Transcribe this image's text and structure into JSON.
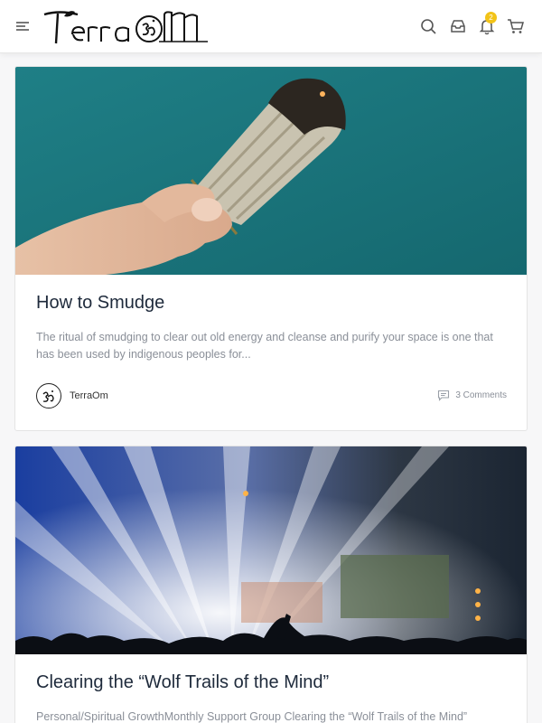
{
  "header": {
    "brand": "TerraOm",
    "notification_count": "2",
    "accent_color": "#f2c318",
    "icons": [
      "menu-icon",
      "search-icon",
      "inbox-icon",
      "bell-icon",
      "cart-icon"
    ]
  },
  "posts": [
    {
      "title": "How to Smudge",
      "excerpt": "The ritual of smudging to clear out old energy and cleanse and purify your space is one that has been used by indigenous peoples for...",
      "author": "TerraOm",
      "comments": "3 Comments"
    },
    {
      "title": "Clearing the “Wolf Trails of the Mind”",
      "excerpt": "Personal/Spiritual GrowthMonthly Support Group Clearing the “Wolf Trails of the Mind”"
    }
  ]
}
